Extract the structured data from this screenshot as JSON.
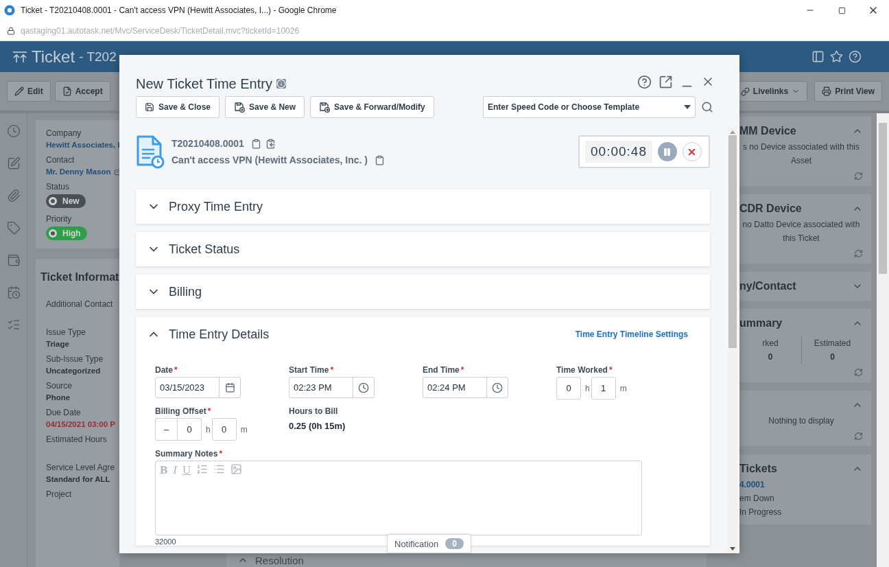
{
  "browser": {
    "title": "Ticket - T20210408.0001 - Can't access VPN (Hewitt Associates, I...) - Google Chrome",
    "url": "qastaging01.autotask.net/Mvc/ServiceDesk/TicketDetail.mvc?ticketId=10026"
  },
  "header": {
    "title": "Ticket",
    "subtitle": "- T202"
  },
  "toolbar": {
    "left": [
      {
        "label": "Edit",
        "kind": "edit"
      },
      {
        "label": "Accept",
        "kind": "accept"
      }
    ],
    "right": [
      {
        "label": "Livelinks",
        "kind": "menu"
      },
      {
        "label": "Print View",
        "kind": "print"
      }
    ]
  },
  "left_panel": {
    "summary": [
      {
        "label": "Company",
        "value": "Hewitt Associates, I",
        "kind": "link"
      },
      {
        "label": "Contact",
        "value": "Mr. Denny Mason",
        "kind": "link-edit"
      },
      {
        "label": "Status",
        "value": "New",
        "kind": "pill",
        "color": "#4a4f55"
      },
      {
        "label": "Priority",
        "value": "High",
        "kind": "pill",
        "color": "#2e9e48"
      }
    ],
    "info_title": "Ticket Informat",
    "info": [
      {
        "label": "Additional Contact",
        "kind": "text"
      },
      {
        "label": "Issue Type",
        "value": "Triage",
        "kind": "text"
      },
      {
        "label": "Sub-Issue Type",
        "value": "Uncategorized",
        "kind": "text"
      },
      {
        "label": "Source",
        "value": "Phone",
        "kind": "text"
      },
      {
        "label": "Due Date",
        "value": "04/15/2021 03:00 P",
        "kind": "alert"
      },
      {
        "label": "Estimated Hours",
        "kind": "text"
      },
      {
        "label": "Service Level Agre",
        "value": "Standard for ALL",
        "kind": "text"
      },
      {
        "label": "Project",
        "kind": "text"
      }
    ]
  },
  "right_panel": [
    {
      "title": "MM Device",
      "expanded": true,
      "kind": "message",
      "lines": [
        "s no Device associated with this",
        "Asset"
      ]
    },
    {
      "title": "CDR Device",
      "expanded": true,
      "kind": "message",
      "lines": [
        "no Datto Device associated with",
        "this Ticket"
      ]
    },
    {
      "title": "ny/Contact",
      "expanded": false
    },
    {
      "title": "ummary",
      "expanded": true,
      "kind": "stats",
      "stats": [
        {
          "label": "rked",
          "value": "0"
        },
        {
          "label": "Estimated",
          "value": "0"
        }
      ]
    },
    {
      "expanded": true,
      "kind": "message",
      "lines": [
        "Nothing to display"
      ]
    },
    {
      "title": "Tickets",
      "expanded": true,
      "kind": "list",
      "link": "4.0001",
      "lines": [
        "em Down",
        "In Progress"
      ]
    }
  ],
  "background_section": {
    "title": "Resolution",
    "expanded": true
  },
  "modal": {
    "title": "New Ticket Time Entry",
    "buttons": [
      {
        "label": "Save & Close",
        "kind": "save"
      },
      {
        "label": "Save & New",
        "kind": "save-new"
      },
      {
        "label": "Save & Forward/Modify",
        "kind": "save-forward"
      }
    ],
    "template": {
      "placeholder": "Enter Speed Code or Choose Template"
    },
    "ticket": {
      "number": "T20210408.0001",
      "title": "Can't access VPN (Hewitt Associates, Inc. )"
    },
    "timer": {
      "time": "00:00:48"
    },
    "sections": [
      {
        "title": "Proxy Time Entry",
        "expanded": false
      },
      {
        "title": "Ticket Status",
        "expanded": false
      },
      {
        "title": "Billing",
        "expanded": false
      },
      {
        "title": "Time Entry Details",
        "expanded": true,
        "link": "Time Entry Timeline Settings"
      }
    ],
    "fields": [
      {
        "label": "Date",
        "required_mark": "*",
        "kind": "date",
        "value": "03/15/2023"
      },
      {
        "label": "Start Time",
        "required_mark": "*",
        "kind": "time",
        "value": "02:23 PM"
      },
      {
        "label": "End Time",
        "required_mark": "*",
        "kind": "time",
        "value": "02:24 PM"
      },
      {
        "label": "Time Worked",
        "required_mark": "*",
        "kind": "duration",
        "hours": "0",
        "hour_unit": "h",
        "minutes": "1",
        "minute_unit": "m"
      },
      {
        "label": "Billing Offset",
        "required_mark": "*",
        "kind": "offset",
        "sign": "–",
        "hours": "0",
        "hour_unit": "h",
        "minutes": "0",
        "minute_unit": "m"
      },
      {
        "label": "Hours to Bill",
        "kind": "readout",
        "value": "0.25 (0h 15m)"
      }
    ],
    "notes": {
      "label": "Summary Notes",
      "required_mark": "*",
      "tools": [
        "B",
        "I",
        "U"
      ],
      "counter": "32000"
    }
  },
  "notification": {
    "label": "Notification",
    "count": "0"
  }
}
